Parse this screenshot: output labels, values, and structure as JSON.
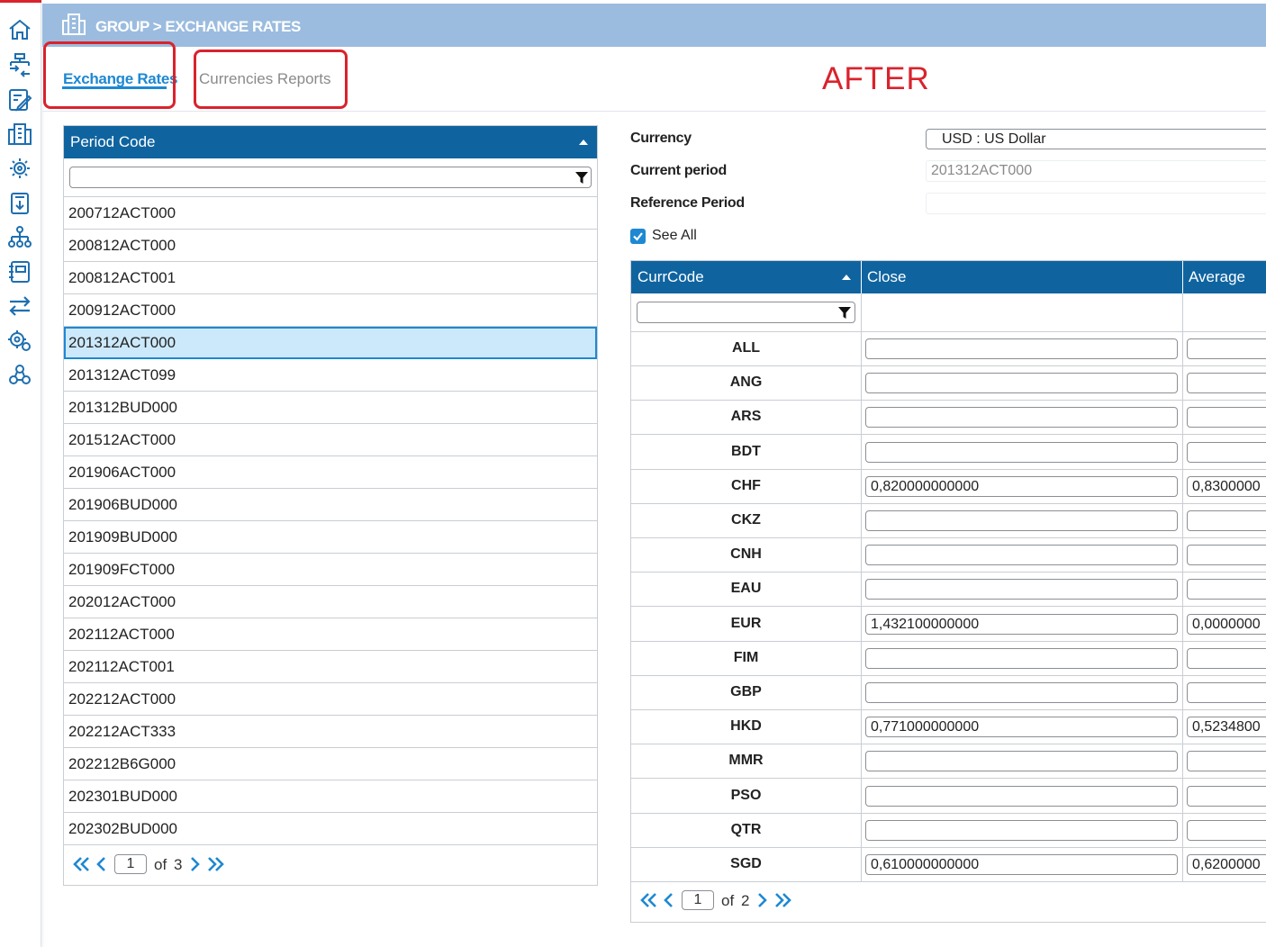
{
  "breadcrumb": "GROUP > EXCHANGE RATES",
  "tabs": [
    {
      "label": "Exchange Rates",
      "active": true
    },
    {
      "label": "Currencies Reports",
      "active": false
    }
  ],
  "annotation": "AFTER",
  "sidebar_icons": [
    "home-icon",
    "hierarchy-transfer-icon",
    "edit-sheet-icon",
    "building-icon",
    "gear-cluster-icon",
    "download-doc-icon",
    "org-chart-icon",
    "notebook-icon",
    "exchange-arrows-icon",
    "settings-gears-icon",
    "network-users-icon"
  ],
  "period_grid": {
    "header": "Period Code",
    "filter_value": "",
    "rows": [
      "200712ACT000",
      "200812ACT000",
      "200812ACT001",
      "200912ACT000",
      "201312ACT000",
      "201312ACT099",
      "201312BUD000",
      "201512ACT000",
      "201906ACT000",
      "201906BUD000",
      "201909BUD000",
      "201909FCT000",
      "202012ACT000",
      "202112ACT000",
      "202112ACT001",
      "202212ACT000",
      "202212ACT333",
      "202212B6G000",
      "202301BUD000",
      "202302BUD000"
    ],
    "selected_index": 4,
    "pager": {
      "page": "1",
      "of_label": "of",
      "total": "3"
    }
  },
  "form": {
    "currency_label": "Currency",
    "currency_value": "USD : US Dollar",
    "current_period_label": "Current period",
    "current_period_value": "201312ACT000",
    "reference_period_label": "Reference Period",
    "reference_period_value": "",
    "see_all_label": "See All",
    "see_all_checked": true
  },
  "rates_grid": {
    "columns": [
      "CurrCode",
      "Close",
      "Average"
    ],
    "filter_value": "",
    "rows": [
      {
        "code": "ALL",
        "close": "",
        "average": ""
      },
      {
        "code": "ANG",
        "close": "",
        "average": ""
      },
      {
        "code": "ARS",
        "close": "",
        "average": ""
      },
      {
        "code": "BDT",
        "close": "",
        "average": ""
      },
      {
        "code": "CHF",
        "close": "0,820000000000",
        "average": "0,8300000"
      },
      {
        "code": "CKZ",
        "close": "",
        "average": ""
      },
      {
        "code": "CNH",
        "close": "",
        "average": ""
      },
      {
        "code": "EAU",
        "close": "",
        "average": ""
      },
      {
        "code": "EUR",
        "close": "1,432100000000",
        "average": "0,0000000"
      },
      {
        "code": "FIM",
        "close": "",
        "average": ""
      },
      {
        "code": "GBP",
        "close": "",
        "average": ""
      },
      {
        "code": "HKD",
        "close": "0,771000000000",
        "average": "0,5234800"
      },
      {
        "code": "MMR",
        "close": "",
        "average": ""
      },
      {
        "code": "PSO",
        "close": "",
        "average": ""
      },
      {
        "code": "QTR",
        "close": "",
        "average": ""
      },
      {
        "code": "SGD",
        "close": "0,610000000000",
        "average": "0,6200000"
      }
    ],
    "pager": {
      "page": "1",
      "of_label": "of",
      "total": "2"
    }
  },
  "colors": {
    "header_blue": "#0f64a0",
    "topbar": "#9bbcdf",
    "accent": "#1e88d2",
    "highlight_red": "#d9232d",
    "selected_row": "#cce9fb"
  }
}
